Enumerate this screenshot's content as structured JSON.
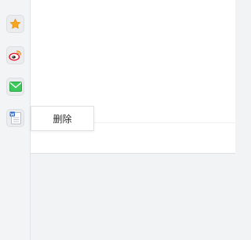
{
  "sidebar": {
    "apps": [
      {
        "icon": "star-icon",
        "color": "#f5a623"
      },
      {
        "icon": "weibo-icon",
        "color": "#e6162d"
      },
      {
        "icon": "mail-icon",
        "color": "#3cc85c"
      },
      {
        "icon": "word-document-icon",
        "color": "#2b66c4"
      }
    ]
  },
  "context_menu": {
    "items": [
      {
        "label": "删除"
      }
    ]
  }
}
